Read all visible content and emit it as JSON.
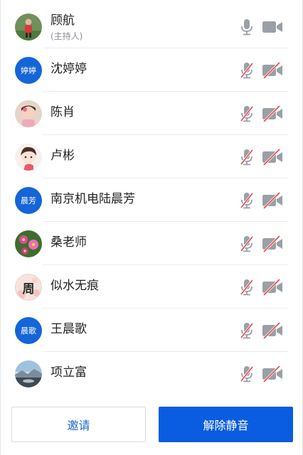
{
  "participants": [
    {
      "name": "顾航",
      "role": "(主持人)",
      "avatar_text": "",
      "avatar_style": "photo-person",
      "mic": "on",
      "camera": "on"
    },
    {
      "name": "沈婷婷",
      "avatar_text": "婷婷",
      "mic": "muted",
      "camera": "off"
    },
    {
      "name": "陈肖",
      "avatar_text": "",
      "avatar_style": "photo-child",
      "mic": "muted",
      "camera": "off"
    },
    {
      "name": "卢彬",
      "avatar_text": "",
      "avatar_style": "photo-cartoon",
      "mic": "muted",
      "camera": "off"
    },
    {
      "name": "南京机电陆晨芳",
      "avatar_text": "晨芳",
      "mic": "muted",
      "camera": "off"
    },
    {
      "name": "桑老师",
      "avatar_text": "",
      "avatar_style": "photo-flowers",
      "mic": "muted",
      "camera": "off"
    },
    {
      "name": "似水无痕",
      "avatar_text": "周",
      "avatar_style": "photo-calligraphy",
      "mic": "muted",
      "camera": "off"
    },
    {
      "name": "王晨歌",
      "avatar_text": "晨歌",
      "mic": "muted",
      "camera": "off"
    },
    {
      "name": "项立富",
      "avatar_text": "",
      "avatar_style": "photo-landscape",
      "mic": "muted",
      "camera": "off"
    }
  ],
  "footer": {
    "invite_label": "邀请",
    "unmute_all_label": "解除静音"
  },
  "colors": {
    "accent": "#0a5de0",
    "text_avatar_bg": "#1565d8",
    "icon_on": "#9aa0a6",
    "icon_muted_slash": "#e5484d"
  }
}
